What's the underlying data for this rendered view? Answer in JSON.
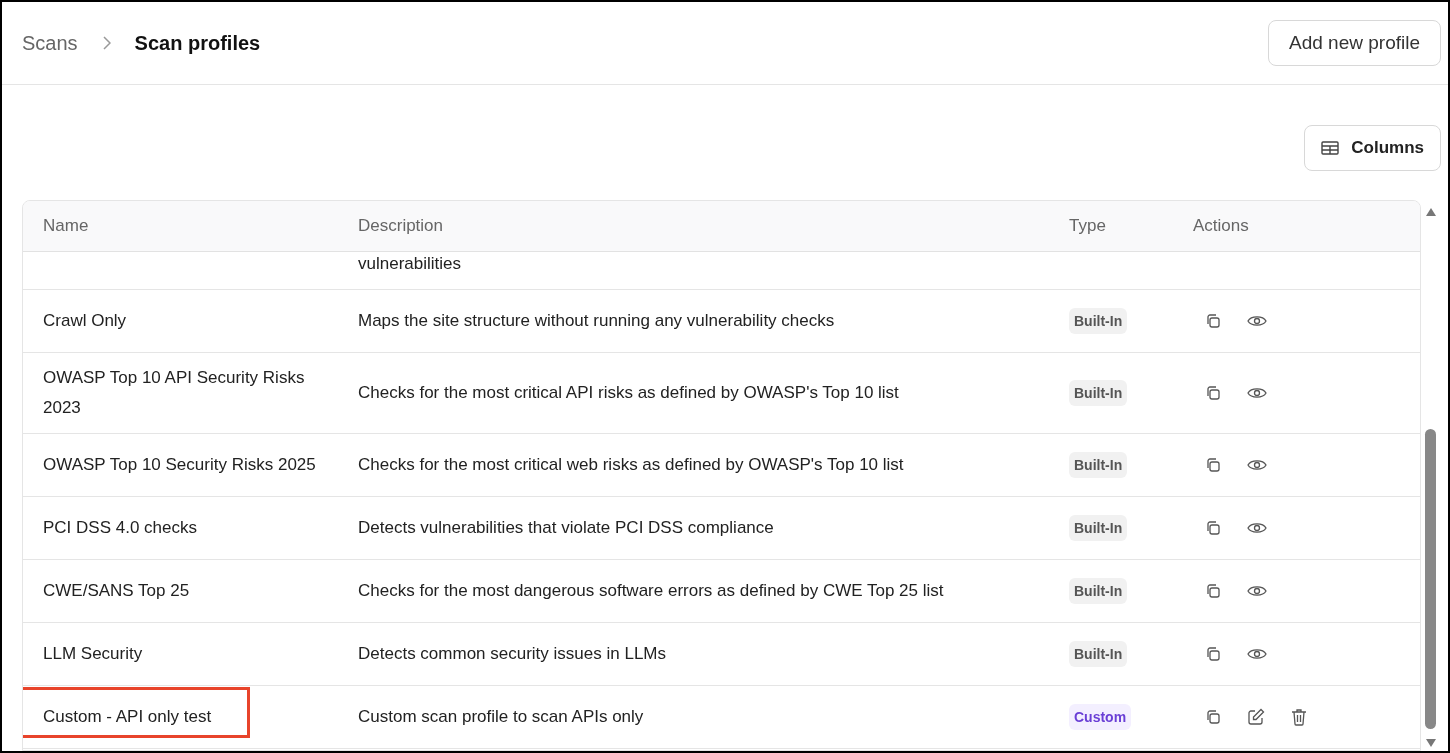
{
  "breadcrumb": [
    {
      "label": "Scans",
      "current": false
    },
    {
      "label": "Scan profiles",
      "current": true
    }
  ],
  "add_button": "Add new profile",
  "columns_button": "Columns",
  "table": {
    "columns": [
      "Name",
      "Description",
      "Type",
      "Actions"
    ],
    "partial_row": {
      "description": "vulnerabilities"
    },
    "rows": [
      {
        "name": "Crawl Only",
        "description": "Maps the site structure without running any vulnerability checks",
        "type": "Built-In",
        "kind": "builtin",
        "highlighted": false
      },
      {
        "name": "OWASP Top 10 API Security Risks 2023",
        "description": "Checks for the most critical API risks as defined by OWASP's Top 10 list",
        "type": "Built-In",
        "kind": "builtin",
        "highlighted": false
      },
      {
        "name": "OWASP Top 10 Security Risks 2025",
        "description": "Checks for the most critical web risks as defined by OWASP's Top 10 list",
        "type": "Built-In",
        "kind": "builtin",
        "highlighted": false
      },
      {
        "name": "PCI DSS 4.0 checks",
        "description": "Detects vulnerabilities that violate PCI DSS compliance",
        "type": "Built-In",
        "kind": "builtin",
        "highlighted": false
      },
      {
        "name": "CWE/SANS Top 25",
        "description": "Checks for the most dangerous software errors as defined by CWE Top 25 list",
        "type": "Built-In",
        "kind": "builtin",
        "highlighted": false
      },
      {
        "name": "LLM Security",
        "description": "Detects common security issues in LLMs",
        "type": "Built-In",
        "kind": "builtin",
        "highlighted": false
      },
      {
        "name": "Custom - API only test",
        "description": "Custom scan profile to scan APIs only",
        "type": "Custom",
        "kind": "custom",
        "highlighted": true
      }
    ]
  }
}
